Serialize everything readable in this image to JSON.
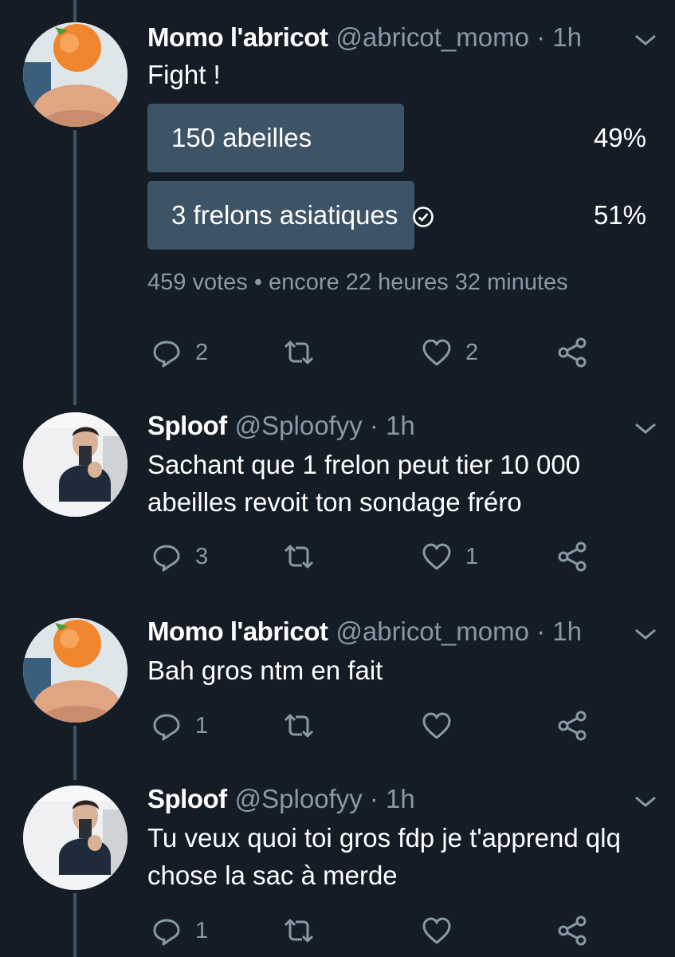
{
  "colors": {
    "background": "#141d26",
    "bar": "#3d5466",
    "muted": "#8899a6",
    "text": "#ffffff"
  },
  "tweets": [
    {
      "name": "Momo l'abricot",
      "handle": "@abricot_momo · 1h",
      "text": "Fight !",
      "poll": {
        "options": [
          {
            "label": "150 abeilles",
            "percent": "49%",
            "share": 0.49,
            "winner": false
          },
          {
            "label": "3 frelons asiatiques",
            "percent": "51%",
            "share": 0.51,
            "winner": true
          }
        ],
        "meta": "459 votes • encore 22 heures 32 minutes"
      },
      "replies": "2",
      "retweets": "",
      "likes": "2"
    },
    {
      "name": "Sploof",
      "handle": "@Sploofyy · 1h",
      "text": "Sachant que 1 frelon peut tier 10 000 abeilles revoit ton sondage fréro",
      "replies": "3",
      "retweets": "",
      "likes": "1"
    },
    {
      "name": "Momo l'abricot",
      "handle": "@abricot_momo · 1h",
      "text": "Bah gros ntm en fait",
      "replies": "1",
      "retweets": "",
      "likes": ""
    },
    {
      "name": "Sploof",
      "handle": "@Sploofyy · 1h",
      "text": "Tu veux quoi toi gros fdp je t'apprend qlq chose la sac à merde",
      "replies": "1",
      "retweets": "",
      "likes": ""
    }
  ],
  "icons": [
    "reply-icon",
    "retweet-icon",
    "like-icon",
    "share-icon",
    "chevron-down-icon",
    "check-circle-icon"
  ]
}
